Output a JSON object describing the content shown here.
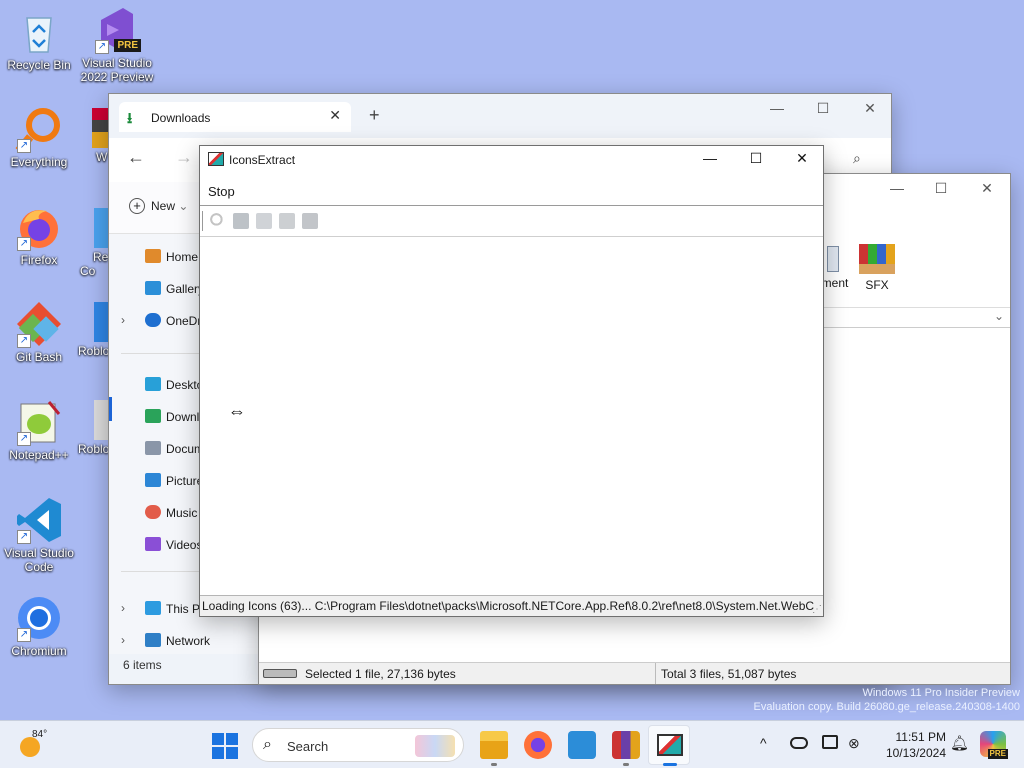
{
  "desktop": {
    "icons": [
      {
        "label": "Recycle Bin"
      },
      {
        "label": "Visual Studio 2022 Preview",
        "badge": "PRE"
      },
      {
        "label": "Everything"
      },
      {
        "label": "Firefox"
      },
      {
        "label": "Git Bash"
      },
      {
        "label": "Notepad++"
      },
      {
        "label": "Visual Studio Code"
      },
      {
        "label": "Chromium"
      }
    ],
    "partial_icons": [
      "W",
      "Re Co",
      "Roblo",
      "Roblo"
    ]
  },
  "explorer": {
    "tab_label": "Downloads",
    "new_label": "New",
    "sidebar": [
      "Home",
      "Gallery",
      "OneDr",
      "Deskto",
      "Downl",
      "Docum",
      "Picture",
      "Music",
      "Videos",
      "This P",
      "Network"
    ],
    "status": "6 items"
  },
  "explorer2": {
    "items": [
      "ment",
      "SFX"
    ],
    "status_left": "Selected 1 file, 27,136 bytes",
    "status_right": "Total 3 files, 51,087 bytes"
  },
  "iconsextract": {
    "title": "IconsExtract",
    "menu": "Stop",
    "status": "Loading Icons (63)... C:\\Program Files\\dotnet\\packs\\Microsoft.NETCore.App.Ref\\8.0.2\\ref\\net8.0\\System.Net.WebC"
  },
  "watermark": {
    "line1": "Windows 11 Pro Insider Preview",
    "line2": "Evaluation copy. Build 26080.ge_release.240308-1400"
  },
  "taskbar": {
    "weather": "84°",
    "search": "Search",
    "time": "11:51 PM",
    "date": "10/13/2024",
    "tray_badge": "PRE"
  },
  "colors": {
    "desktop": "#a9b9f2",
    "accent": "#1c64d6",
    "taskbar": "#e9eef8"
  }
}
